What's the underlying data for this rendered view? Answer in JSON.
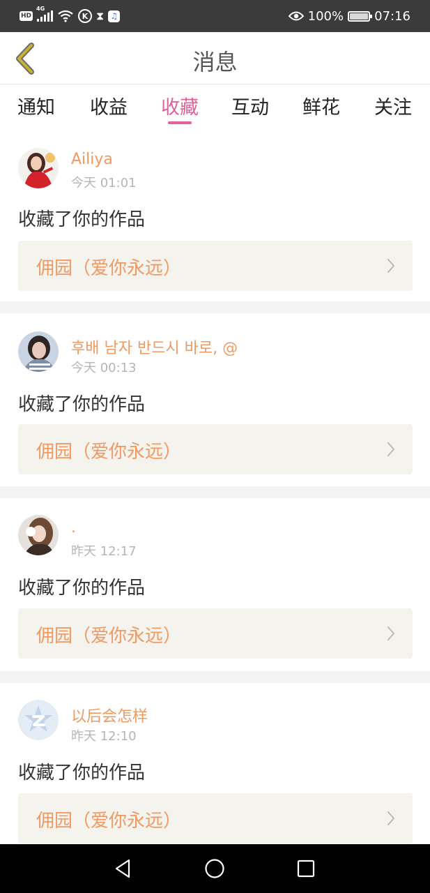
{
  "status_bar": {
    "network_badge": "HD",
    "network_type": "4G",
    "k_badge": "K",
    "battery_percent": "100%",
    "time": "07:16",
    "icons": [
      "hd-icon",
      "signal-icon",
      "wifi-icon",
      "k-app-icon",
      "hourglass-icon",
      "music-app-icon",
      "eye-icon",
      "battery-icon"
    ]
  },
  "header": {
    "title": "消息",
    "back_icon": "chevron-left-icon"
  },
  "tabs": [
    {
      "label": "通知",
      "active": false
    },
    {
      "label": "收益",
      "active": false
    },
    {
      "label": "收藏",
      "active": true
    },
    {
      "label": "互动",
      "active": false
    },
    {
      "label": "鲜花",
      "active": false
    },
    {
      "label": "关注",
      "active": false
    }
  ],
  "notifications": [
    {
      "username": "Ailiya",
      "time": "今天 01:01",
      "action": "收藏了你的作品",
      "work_title": "佣园（爱你永远）"
    },
    {
      "username": "후배 남자 반드시 바로, @",
      "time": "今天 00:13",
      "action": "收藏了你的作品",
      "work_title": "佣园（爱你永远）"
    },
    {
      "username": ".",
      "time": "昨天 12:17",
      "action": "收藏了你的作品",
      "work_title": "佣园（爱你永远）"
    },
    {
      "username": "以后会怎样",
      "time": "昨天 12:10",
      "action": "收藏了你的作品",
      "work_title": "佣园（爱你永远）"
    }
  ],
  "colors": {
    "accent_pink": "#e0619a",
    "username_orange": "#ee9a62",
    "back_chevron": "#c9b233",
    "card_box": "#f5f3ed"
  },
  "nav_bar": {
    "icons": [
      "back-triangle-icon",
      "home-circle-icon",
      "recents-square-icon"
    ]
  }
}
